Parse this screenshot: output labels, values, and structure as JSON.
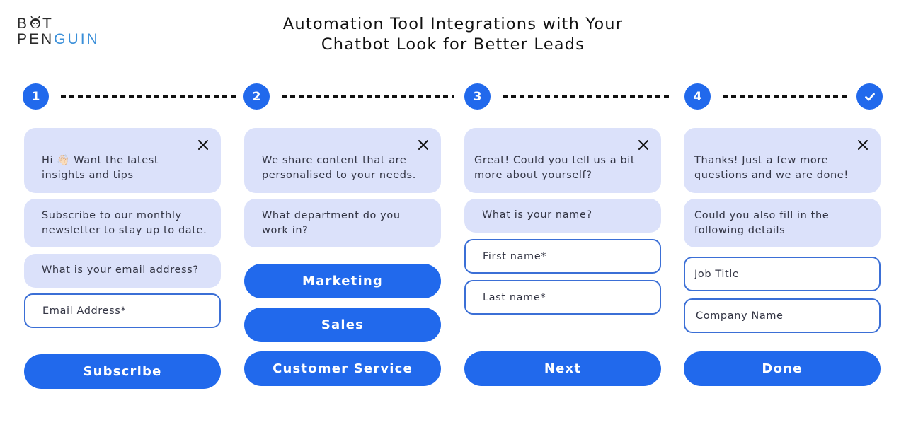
{
  "logo": {
    "line1_b": "B",
    "line1_t": "T",
    "line2_dark": "PEN",
    "line2_blue": "GUIN",
    "brand_blue": "#3a8fd9"
  },
  "title": {
    "line1": "Automation Tool Integrations with Your",
    "line2": "Chatbot Look for Better Leads"
  },
  "stepper": {
    "steps": [
      "1",
      "2",
      "3",
      "4"
    ],
    "final_icon": "check-icon",
    "accent": "#2169ec"
  },
  "columns": [
    {
      "intro": "Hi 👋🏻 Want the latest insights and tips",
      "intro_line1": "Hi",
      "intro_emoji": "👋🏻",
      "intro_line1b": "Want the latest",
      "intro_line2": "insights and tips",
      "message_line1": "Subscribe to our monthly",
      "message_line2": "newsletter to stay up to date.",
      "question": "What is your email address?",
      "field_placeholder": "Email Address*",
      "button": "Subscribe"
    },
    {
      "intro_line1": "We share content that are",
      "intro_line2": "personalised to your needs.",
      "message_line1": "What department do you",
      "message_line2": "work in?",
      "options": [
        "Marketing",
        "Sales",
        "Customer Service"
      ]
    },
    {
      "intro_line1": "Great! Could you tell us a bit",
      "intro_line2": "more about yourself?",
      "question": "What is your name?",
      "fields": [
        "First name*",
        "Last name*"
      ],
      "button": "Next"
    },
    {
      "intro_line1": "Thanks! Just a few more",
      "intro_line2": "questions and we are done!",
      "message_line1": "Could you also fill in the",
      "message_line2": "following details",
      "fields": [
        "Job Title",
        "Company Name"
      ],
      "button": "Done"
    }
  ],
  "colors": {
    "bubble_bg": "#dbe1fa",
    "button_bg": "#2169ec",
    "field_border": "#3b6fd6"
  }
}
